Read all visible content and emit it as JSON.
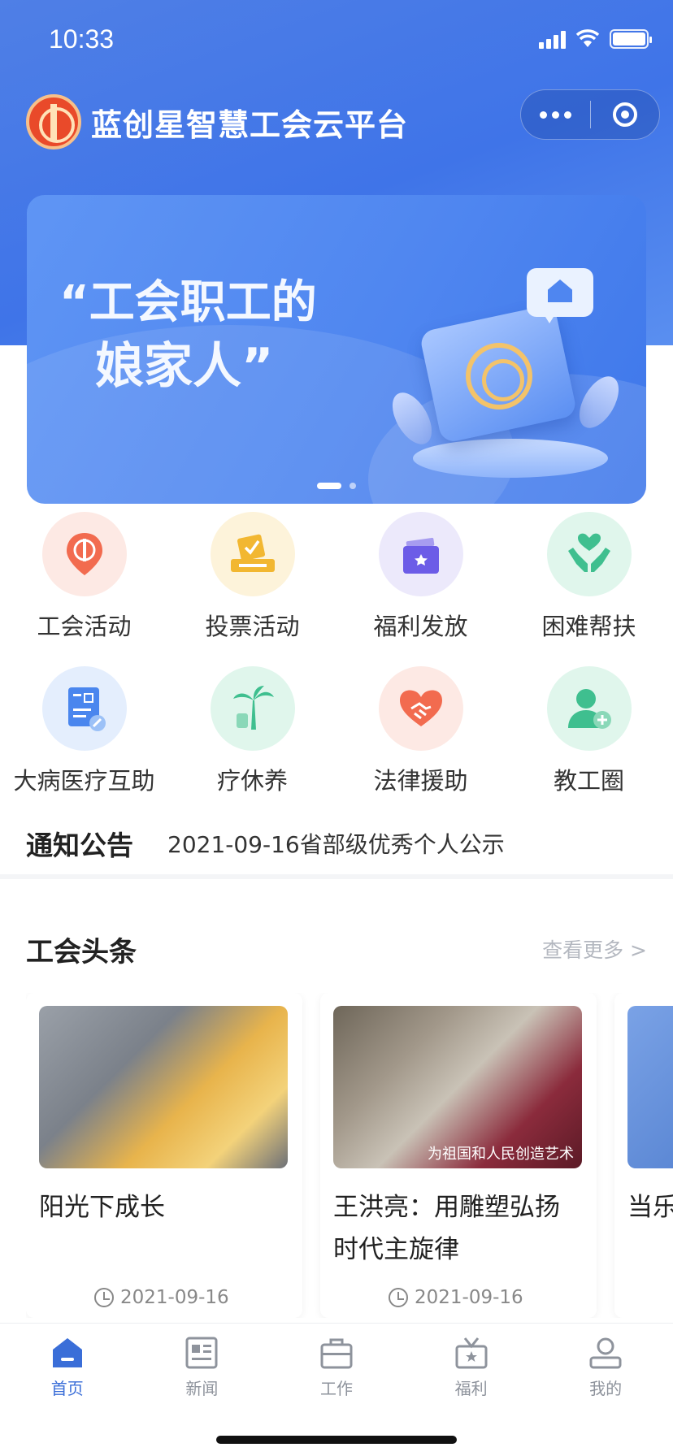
{
  "status_bar": {
    "time": "10:33"
  },
  "header": {
    "title": "蓝创星智慧工会云平台"
  },
  "banner": {
    "slogan_line1": "“工会职工的",
    "slogan_line2": "娘家人”",
    "active_slide": 1,
    "slide_count": 2
  },
  "grid": {
    "row1": [
      {
        "label": "工会活动",
        "icon": "union-badge-icon",
        "color": "#f26b4f",
        "bg": "#fde9e4"
      },
      {
        "label": "投票活动",
        "icon": "ballot-box-icon",
        "color": "#f2b731",
        "bg": "#fdf3da"
      },
      {
        "label": "福利发放",
        "icon": "gift-bag-icon",
        "color": "#6c5ce7",
        "bg": "#ece9fb"
      },
      {
        "label": "困难帮扶",
        "icon": "hands-heart-icon",
        "color": "#3fbf8f",
        "bg": "#e0f6ec"
      }
    ],
    "row2": [
      {
        "label": "大病医疗互助",
        "icon": "medical-form-icon",
        "color": "#4a86ee",
        "bg": "#e4eefd"
      },
      {
        "label": "疗休养",
        "icon": "palm-tree-icon",
        "color": "#3fbf8f",
        "bg": "#e0f6ec"
      },
      {
        "label": "法律援助",
        "icon": "handshake-heart-icon",
        "color": "#f26b4f",
        "bg": "#fde9e4"
      },
      {
        "label": "教工圈",
        "icon": "user-add-icon",
        "color": "#3fbf8f",
        "bg": "#e0f6ec"
      }
    ]
  },
  "notice": {
    "title": "通知公告",
    "text": "2021-09-16省部级优秀个人公示"
  },
  "news": {
    "title": "工会头条",
    "more": "查看更多 >",
    "cards": [
      {
        "title": "阳光下成长",
        "date": "2021-09-16",
        "caption": ""
      },
      {
        "title": "王洪亮：用雕塑弘扬时代主旋律",
        "date": "2021-09-16",
        "caption": "为祖国和人民创造艺术"
      },
      {
        "title": "当乐",
        "date": "",
        "caption": ""
      }
    ]
  },
  "tabbar": {
    "active": "首页",
    "accent": "#3a6ed8",
    "items": [
      {
        "label": "首页",
        "icon": "home-icon"
      },
      {
        "label": "新闻",
        "icon": "news-icon"
      },
      {
        "label": "工作",
        "icon": "briefcase-icon"
      },
      {
        "label": "福利",
        "icon": "welfare-gift-icon"
      },
      {
        "label": "我的",
        "icon": "profile-icon"
      }
    ]
  }
}
